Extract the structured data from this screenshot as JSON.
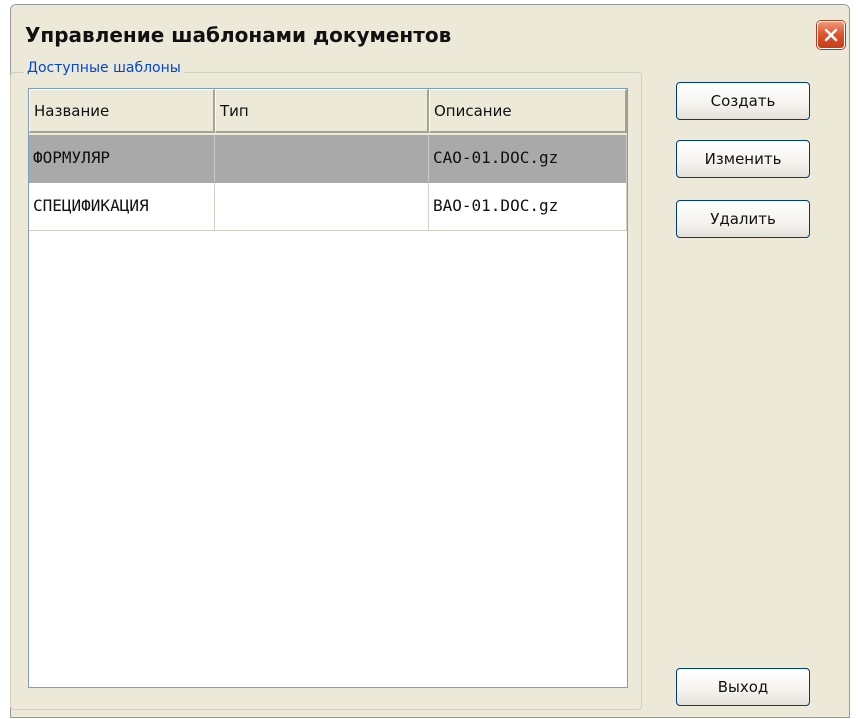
{
  "window": {
    "title": "Управление шаблонами документов"
  },
  "group": {
    "label": "Доступные шаблоны"
  },
  "table": {
    "columns": [
      "Название",
      "Тип",
      "Описание"
    ],
    "rows": [
      {
        "name": "ФОРМУЛЯР",
        "type": "",
        "description": "САО-01.DOC.gz",
        "selected": true
      },
      {
        "name": "СПЕЦИФИКАЦИЯ",
        "type": "",
        "description": "ВАО-01.DOC.gz",
        "selected": false
      }
    ]
  },
  "buttons": {
    "create": "Создать",
    "edit": "Изменить",
    "delete": "Удалить",
    "exit": "Выход"
  },
  "icons": {
    "close": "close-icon"
  },
  "colors": {
    "window_bg": "#ece9d8",
    "group_label": "#0046d5",
    "selected_row": "#a9a9a9",
    "close_button": "#e1552e",
    "button_border": "#003c74"
  }
}
